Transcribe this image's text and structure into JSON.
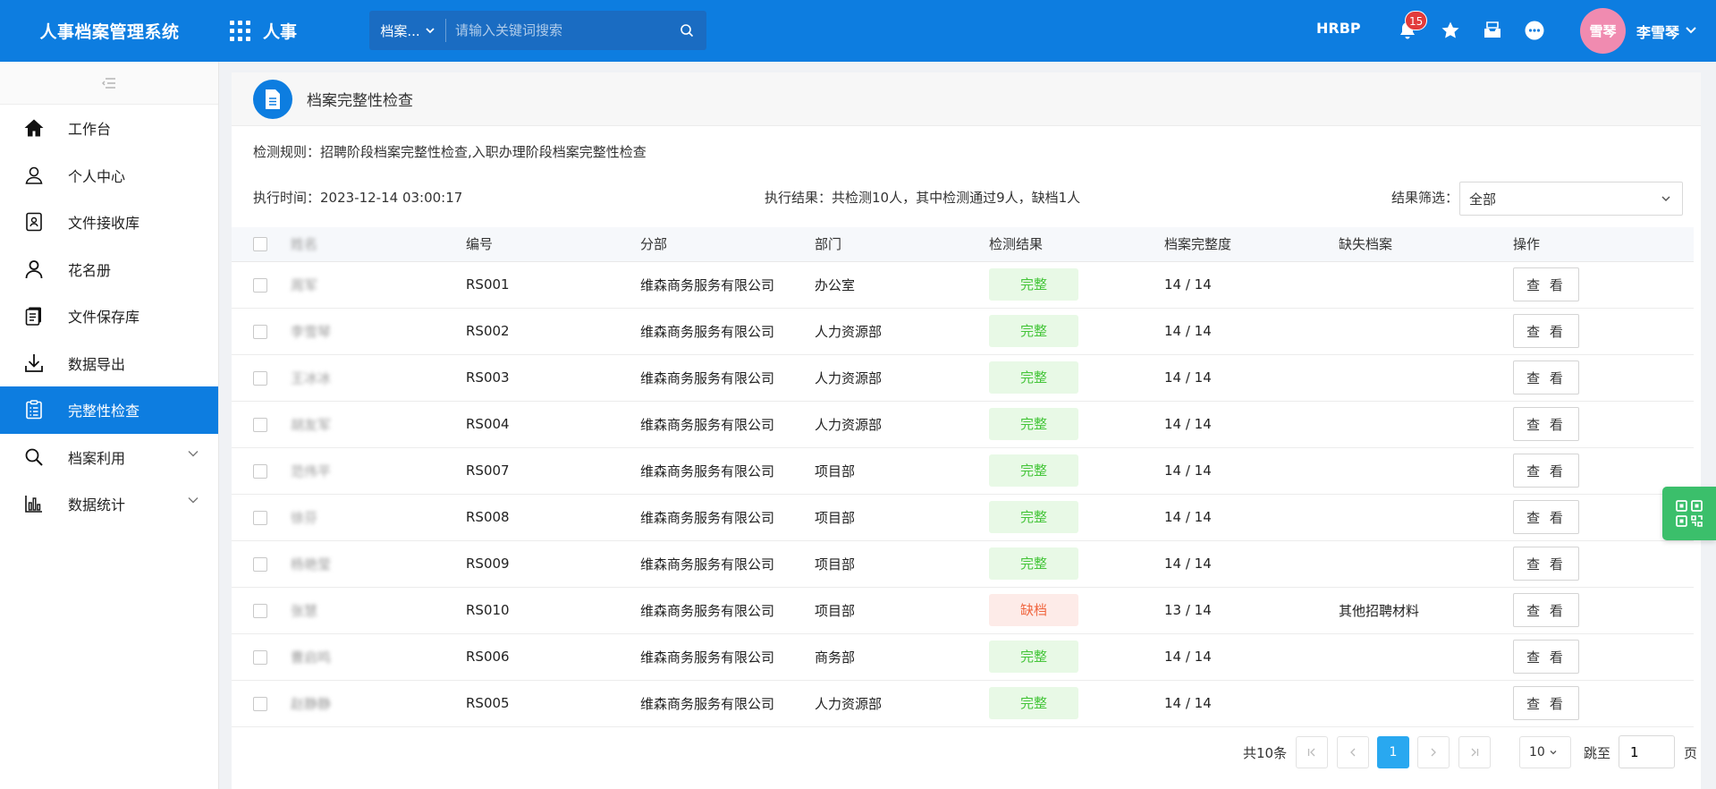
{
  "app": {
    "title": "人事档案管理系统",
    "module": "人事"
  },
  "search": {
    "scope": "档案...",
    "placeholder": "请输入关键词搜索"
  },
  "topbar": {
    "role": "HRBP",
    "notifications": "15",
    "avatar_text": "雪琴",
    "user_name": "李雪琴"
  },
  "colors": {
    "primary": "#0d7de0",
    "success": "#45c53a",
    "danger": "#f0663f",
    "pager_active": "#29a8f0",
    "float": "#3bbf6b"
  },
  "sidebar": {
    "items": [
      {
        "label": "工作台",
        "icon": "home-icon"
      },
      {
        "label": "个人中心",
        "icon": "user-icon"
      },
      {
        "label": "文件接收库",
        "icon": "file-receive-icon"
      },
      {
        "label": "花名册",
        "icon": "person-icon"
      },
      {
        "label": "文件保存库",
        "icon": "file-store-icon"
      },
      {
        "label": "数据导出",
        "icon": "download-icon"
      },
      {
        "label": "完整性检查",
        "icon": "checklist-icon",
        "active": true
      },
      {
        "label": "档案利用",
        "icon": "search-icon",
        "expandable": true
      },
      {
        "label": "数据统计",
        "icon": "bar-chart-icon",
        "expandable": true
      }
    ]
  },
  "page": {
    "title": "档案完整性检查",
    "rule": "检测规则：招聘阶段档案完整性检查,入职办理阶段档案完整性检查",
    "exec_time": "执行时间：2023-12-14 03:00:17",
    "exec_result": "执行结果：共检测10人，其中检测通过9人，缺档1人",
    "filter_label": "结果筛选：",
    "filter_value": "全部"
  },
  "table": {
    "headers": [
      "姓名",
      "编号",
      "分部",
      "部门",
      "检测结果",
      "档案完整度",
      "缺失档案",
      "操作"
    ],
    "action_label": "查 看",
    "rows": [
      {
        "name": "周军",
        "id": "RS001",
        "branch": "维森商务服务有限公司",
        "dept": "办公室",
        "result": "完整",
        "status": "ok",
        "completeness": "14 / 14",
        "missing": ""
      },
      {
        "name": "李雪琴",
        "id": "RS002",
        "branch": "维森商务服务有限公司",
        "dept": "人力资源部",
        "result": "完整",
        "status": "ok",
        "completeness": "14 / 14",
        "missing": ""
      },
      {
        "name": "王冰冰",
        "id": "RS003",
        "branch": "维森商务服务有限公司",
        "dept": "人力资源部",
        "result": "完整",
        "status": "ok",
        "completeness": "14 / 14",
        "missing": ""
      },
      {
        "name": "胡友军",
        "id": "RS004",
        "branch": "维森商务服务有限公司",
        "dept": "人力资源部",
        "result": "完整",
        "status": "ok",
        "completeness": "14 / 14",
        "missing": ""
      },
      {
        "name": "范伟平",
        "id": "RS007",
        "branch": "维森商务服务有限公司",
        "dept": "项目部",
        "result": "完整",
        "status": "ok",
        "completeness": "14 / 14",
        "missing": ""
      },
      {
        "name": "徐芬",
        "id": "RS008",
        "branch": "维森商务服务有限公司",
        "dept": "项目部",
        "result": "完整",
        "status": "ok",
        "completeness": "14 / 14",
        "missing": ""
      },
      {
        "name": "杨艳莹",
        "id": "RS009",
        "branch": "维森商务服务有限公司",
        "dept": "项目部",
        "result": "完整",
        "status": "ok",
        "completeness": "14 / 14",
        "missing": ""
      },
      {
        "name": "张慧",
        "id": "RS010",
        "branch": "维森商务服务有限公司",
        "dept": "项目部",
        "result": "缺档",
        "status": "miss",
        "completeness": "13 / 14",
        "missing": "其他招聘材料"
      },
      {
        "name": "曹启鸣",
        "id": "RS006",
        "branch": "维森商务服务有限公司",
        "dept": "商务部",
        "result": "完整",
        "status": "ok",
        "completeness": "14 / 14",
        "missing": ""
      },
      {
        "name": "赵静静",
        "id": "RS005",
        "branch": "维森商务服务有限公司",
        "dept": "人力资源部",
        "result": "完整",
        "status": "ok",
        "completeness": "14 / 14",
        "missing": ""
      }
    ]
  },
  "pagination": {
    "total": "共10条",
    "current_page": "1",
    "page_size": "10",
    "jump_label": "跳至",
    "jump_value": "1",
    "page_suffix": "页"
  }
}
